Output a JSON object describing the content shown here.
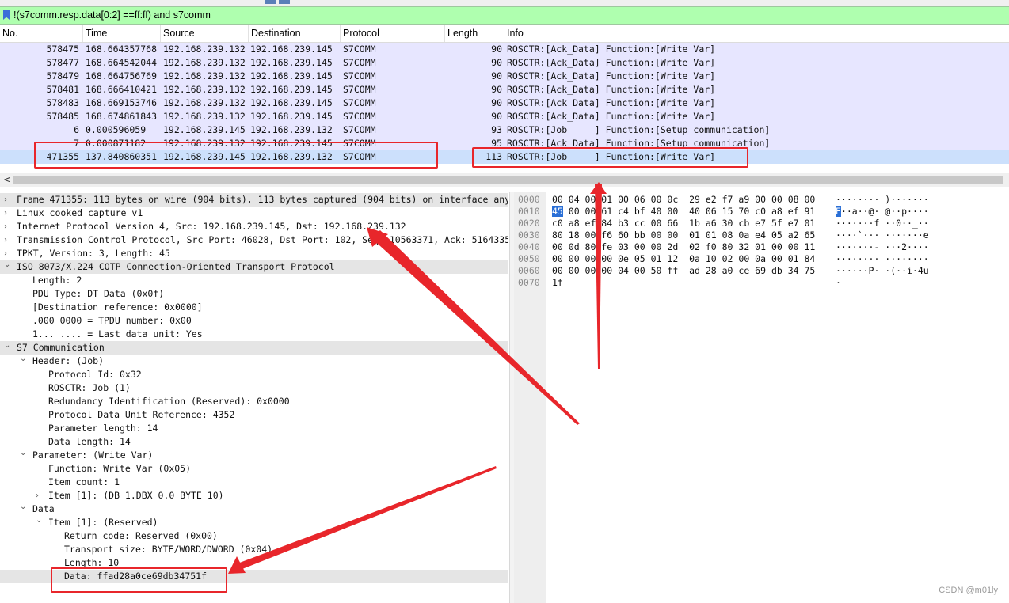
{
  "filter": {
    "text": "!(s7comm.resp.data[0:2] ==ff:ff) and s7comm"
  },
  "packet_list": {
    "columns": [
      "No.",
      "Time",
      "Source",
      "Destination",
      "Protocol",
      "Length",
      "Info"
    ],
    "rows": [
      {
        "no": "578475",
        "time": "168.664357768",
        "src": "192.168.239.132",
        "dst": "192.168.239.145",
        "proto": "S7COMM",
        "len": "90",
        "info": "ROSCTR:[Ack_Data] Function:[Write Var]"
      },
      {
        "no": "578477",
        "time": "168.664542044",
        "src": "192.168.239.132",
        "dst": "192.168.239.145",
        "proto": "S7COMM",
        "len": "90",
        "info": "ROSCTR:[Ack_Data] Function:[Write Var]"
      },
      {
        "no": "578479",
        "time": "168.664756769",
        "src": "192.168.239.132",
        "dst": "192.168.239.145",
        "proto": "S7COMM",
        "len": "90",
        "info": "ROSCTR:[Ack_Data] Function:[Write Var]"
      },
      {
        "no": "578481",
        "time": "168.666410421",
        "src": "192.168.239.132",
        "dst": "192.168.239.145",
        "proto": "S7COMM",
        "len": "90",
        "info": "ROSCTR:[Ack_Data] Function:[Write Var]"
      },
      {
        "no": "578483",
        "time": "168.669153746",
        "src": "192.168.239.132",
        "dst": "192.168.239.145",
        "proto": "S7COMM",
        "len": "90",
        "info": "ROSCTR:[Ack_Data] Function:[Write Var]"
      },
      {
        "no": "578485",
        "time": "168.674861843",
        "src": "192.168.239.132",
        "dst": "192.168.239.145",
        "proto": "S7COMM",
        "len": "90",
        "info": "ROSCTR:[Ack_Data] Function:[Write Var]"
      },
      {
        "no": "6",
        "time": "0.000596059",
        "src": "192.168.239.145",
        "dst": "192.168.239.132",
        "proto": "S7COMM",
        "len": "93",
        "info": "ROSCTR:[Job     ] Function:[Setup communication]"
      },
      {
        "no": "7",
        "time": "0.000871182",
        "src": "192.168.239.132",
        "dst": "192.168.239.145",
        "proto": "S7COMM",
        "len": "95",
        "info": "ROSCTR:[Ack_Data] Function:[Setup communication]"
      },
      {
        "no": "471355",
        "time": "137.840860351",
        "src": "192.168.239.145",
        "dst": "192.168.239.132",
        "proto": "S7COMM",
        "len": "113",
        "info": "ROSCTR:[Job     ] Function:[Write Var]"
      }
    ]
  },
  "scrollbar": {
    "left_arrow": "<"
  },
  "details": {
    "rows": [
      {
        "toggle": "collapsed",
        "text": "Frame 471355: 113 bytes on wire (904 bits), 113 bytes captured (904 bits) on interface any"
      },
      {
        "toggle": "collapsed",
        "text": "Linux cooked capture v1"
      },
      {
        "toggle": "collapsed",
        "text": "Internet Protocol Version 4, Src: 192.168.239.145, Dst: 192.168.239.132"
      },
      {
        "toggle": "collapsed",
        "text": "Transmission Control Protocol, Src Port: 46028, Dst Port: 102, Seq: 10563371, Ack: 5164335"
      },
      {
        "toggle": "collapsed",
        "text": "TPKT, Version: 3, Length: 45"
      },
      {
        "toggle": "expanded",
        "text": "ISO 8073/X.224 COTP Connection-Oriented Transport Protocol"
      },
      {
        "toggle": "",
        "text": "Length: 2"
      },
      {
        "toggle": "",
        "text": "PDU Type: DT Data (0x0f)"
      },
      {
        "toggle": "",
        "text": "[Destination reference: 0x0000]"
      },
      {
        "toggle": "",
        "text": ".000 0000 = TPDU number: 0x00"
      },
      {
        "toggle": "",
        "text": "1... .... = Last data unit: Yes"
      },
      {
        "toggle": "expanded",
        "text": "S7 Communication"
      },
      {
        "toggle": "expanded",
        "text": "Header: (Job)"
      },
      {
        "toggle": "",
        "text": "Protocol Id: 0x32"
      },
      {
        "toggle": "",
        "text": "ROSCTR: Job (1)"
      },
      {
        "toggle": "",
        "text": "Redundancy Identification (Reserved): 0x0000"
      },
      {
        "toggle": "",
        "text": "Protocol Data Unit Reference: 4352"
      },
      {
        "toggle": "",
        "text": "Parameter length: 14"
      },
      {
        "toggle": "",
        "text": "Data length: 14"
      },
      {
        "toggle": "expanded",
        "text": "Parameter: (Write Var)"
      },
      {
        "toggle": "",
        "text": "Function: Write Var (0x05)"
      },
      {
        "toggle": "",
        "text": "Item count: 1"
      },
      {
        "toggle": "collapsed",
        "text": "Item [1]: (DB 1.DBX 0.0 BYTE 10)"
      },
      {
        "toggle": "expanded",
        "text": "Data"
      },
      {
        "toggle": "expanded",
        "text": "Item [1]: (Reserved)"
      },
      {
        "toggle": "",
        "text": "Return code: Reserved (0x00)"
      },
      {
        "toggle": "",
        "text": "Transport size: BYTE/WORD/DWORD (0x04)"
      },
      {
        "toggle": "",
        "text": "Length: 10"
      },
      {
        "toggle": "",
        "text": "Data: ffad28a0ce69db34751f"
      }
    ]
  },
  "bytes": {
    "rows": [
      {
        "off": "0000",
        "hex_pre": "",
        "hex_sel": "",
        "hex_post": "00 04 00 01 00 06 00 0c  29 e2 f7 a9 00 00 08 00",
        "asc_pre": "",
        "asc_sel": "",
        "asc_post": "········ )·······"
      },
      {
        "off": "0010",
        "hex_pre": "",
        "hex_sel": "45",
        "hex_post": " 00 00 61 c4 bf 40 00  40 06 15 70 c0 a8 ef 91",
        "asc_pre": "",
        "asc_sel": "E",
        "asc_post": "··a··@· @··p····"
      },
      {
        "off": "0020",
        "hex_pre": "",
        "hex_sel": "",
        "hex_post": "c0 a8 ef 84 b3 cc 00 66  1b a6 30 cb e7 5f e7 01",
        "asc_pre": "",
        "asc_sel": "",
        "asc_post": "·······f ··0··_··"
      },
      {
        "off": "0030",
        "hex_pre": "",
        "hex_sel": "",
        "hex_post": "80 18 00 f6 60 bb 00 00  01 01 08 0a e4 05 a2 65",
        "asc_pre": "",
        "asc_sel": "",
        "asc_post": "····`··· ·······e"
      },
      {
        "off": "0040",
        "hex_pre": "",
        "hex_sel": "",
        "hex_post": "00 0d 80 fe 03 00 00 2d  02 f0 80 32 01 00 00 11",
        "asc_pre": "",
        "asc_sel": "",
        "asc_post": "·······- ···2····"
      },
      {
        "off": "0050",
        "hex_pre": "",
        "hex_sel": "",
        "hex_post": "00 00 00 00 0e 05 01 12  0a 10 02 00 0a 00 01 84",
        "asc_pre": "",
        "asc_sel": "",
        "asc_post": "········ ········"
      },
      {
        "off": "0060",
        "hex_pre": "",
        "hex_sel": "",
        "hex_post": "00 00 00 00 04 00 50 ff  ad 28 a0 ce 69 db 34 75",
        "asc_pre": "",
        "asc_sel": "",
        "asc_post": "······P· ·(··i·4u"
      },
      {
        "off": "0070",
        "hex_pre": "",
        "hex_sel": "",
        "hex_post": "1f",
        "asc_pre": "",
        "asc_sel": "",
        "asc_post": "·"
      }
    ]
  },
  "watermark": "CSDN @m01ly",
  "colors": {
    "filter_bg": "#afffaf",
    "row_bg": "#e7e6ff",
    "selected_row_bg": "#cce0fc",
    "annotation_red": "#e8262b",
    "byte_highlight": "#2a6fd6"
  }
}
